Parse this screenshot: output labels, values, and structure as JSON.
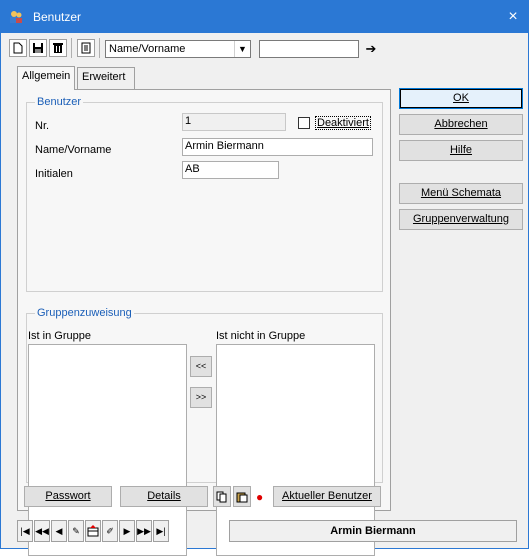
{
  "window": {
    "title": "Benutzer",
    "close_glyph": "×"
  },
  "toolbar": {
    "icons": [
      "new-document-icon",
      "save-disk-icon",
      "delete-trash-icon",
      "print-preview-icon"
    ],
    "search_field_value": "Name/Vorname",
    "search_input_value": "",
    "go_glyph": "➔"
  },
  "tabs": [
    {
      "label": "Allgemein",
      "active": true
    },
    {
      "label": "Erweitert",
      "active": false
    }
  ],
  "benutzer": {
    "legend": "Benutzer",
    "nr_label": "Nr.",
    "nr_value": "1",
    "deaktiviert_label": "Deaktiviert",
    "deaktiviert_checked": false,
    "name_label": "Name/Vorname",
    "name_value": "Armin Biermann",
    "initialen_label": "Initialen",
    "initialen_value": "AB"
  },
  "gruppen": {
    "legend": "Gruppenzuweisung",
    "in_label": "Ist in Gruppe",
    "not_in_label": "Ist nicht in Gruppe",
    "move_left": "<<",
    "move_right": ">>"
  },
  "bottom_buttons": {
    "passwort": "Passwort",
    "details": "Details",
    "aktueller_benutzer": "Aktueller Benutzer"
  },
  "side_buttons": {
    "ok": "OK",
    "abbrechen": "Abbrechen",
    "hilfe": "Hilfe",
    "menu_schemata": "Menü Schemata",
    "gruppenverwaltung": "Gruppenverwaltung"
  },
  "statusbar": {
    "current_record": "Armin Biermann"
  },
  "colors": {
    "accent": "#2b78d4",
    "legend_text": "#1b5fb8",
    "marker_red": "#e00000"
  }
}
